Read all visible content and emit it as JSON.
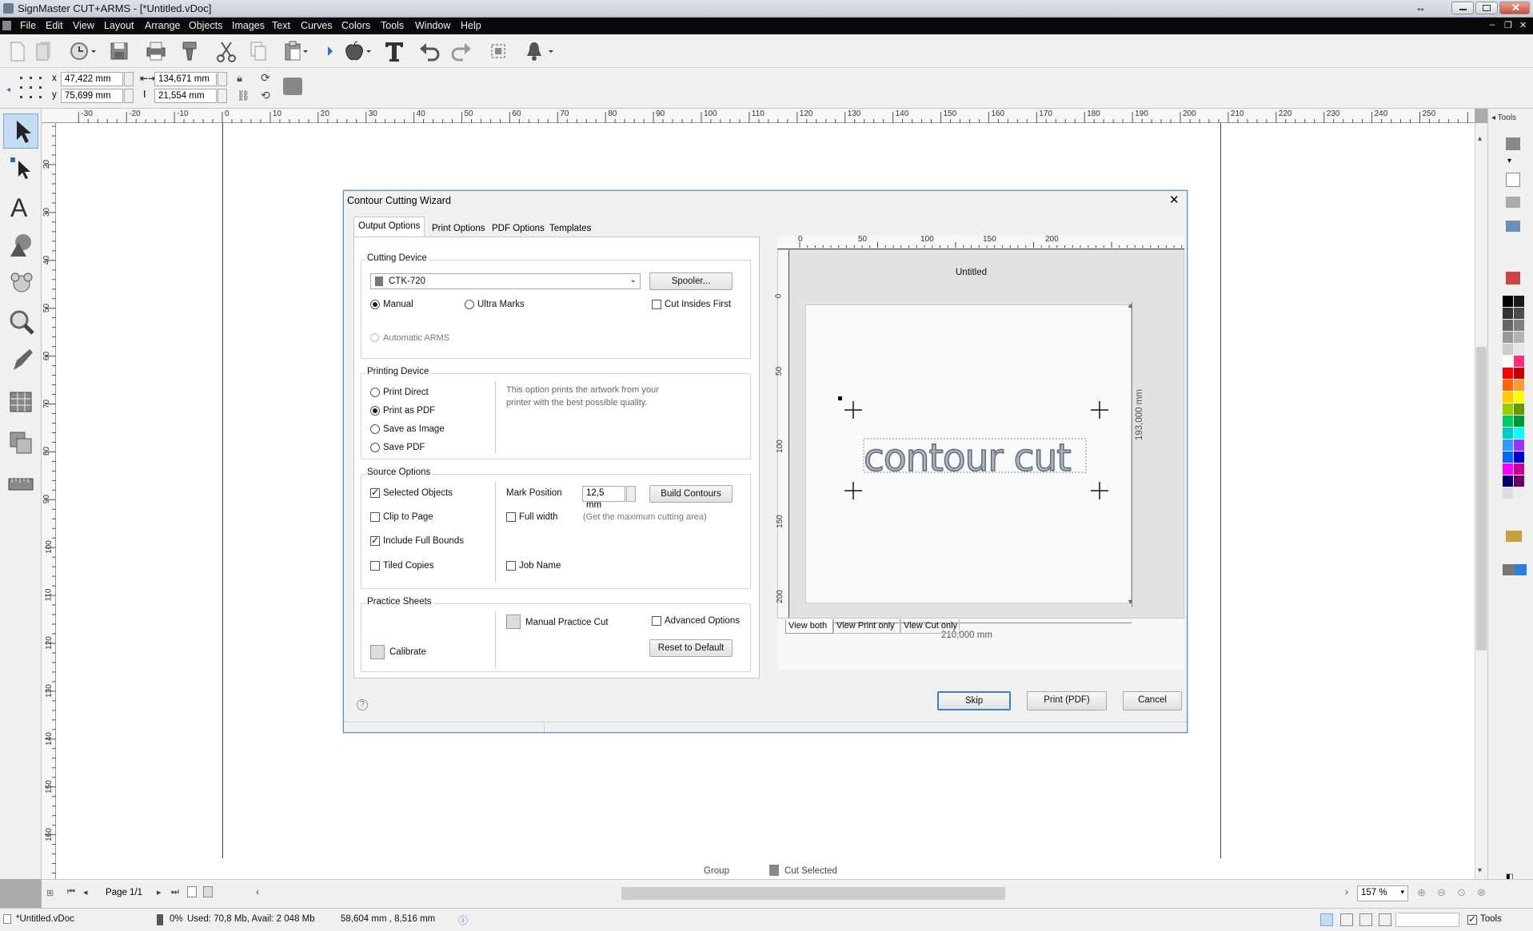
{
  "app": {
    "title": "SignMaster CUT+ARMS - [*Untitled.vDoc]"
  },
  "menu": [
    "File",
    "Edit",
    "View",
    "Layout",
    "Arrange",
    "Objects",
    "Images",
    "Text",
    "Curves",
    "Colors",
    "Tools",
    "Window",
    "Help"
  ],
  "propbar": {
    "x_label": "x",
    "x_value": "47,422 mm",
    "y_label": "y",
    "y_value": "75,699 mm",
    "w_value": "134,671 mm",
    "h_value": "21,554 mm"
  },
  "hruler_labels": [
    "-30",
    "-20",
    "-10",
    "0",
    "10",
    "20",
    "30",
    "40",
    "50",
    "60",
    "70",
    "80",
    "90",
    "100",
    "110",
    "120",
    "130",
    "140",
    "150",
    "160",
    "170",
    "180",
    "190",
    "200",
    "210",
    "220",
    "230",
    "240",
    "250"
  ],
  "vruler_labels": [
    "20",
    "30",
    "40",
    "50",
    "60",
    "70",
    "80",
    "90",
    "100",
    "110",
    "120",
    "130",
    "140",
    "150",
    "160"
  ],
  "canvas": {
    "group_label": "Group",
    "cut_selected_label": "Cut Selected"
  },
  "dialog": {
    "title": "Contour Cutting Wizard",
    "tabs": [
      "Output Options",
      "Print Options",
      "PDF Options",
      "Templates"
    ],
    "cutting_device": {
      "title": "Cutting Device",
      "device": "CTK-720",
      "spooler_button": "Spooler...",
      "manual": "Manual",
      "ultra_marks": "Ultra Marks",
      "cut_insides_first": "Cut Insides First",
      "automatic_arms": "Automatic ARMS"
    },
    "printing_device": {
      "title": "Printing Device",
      "options": [
        "Print Direct",
        "Print as PDF",
        "Save as Image",
        "Save PDF"
      ],
      "selected": "Print as PDF",
      "description": "This option prints the artwork from your printer with the best possible quality."
    },
    "source_options": {
      "title": "Source Options",
      "selected_objects": "Selected Objects",
      "clip_to_page": "Clip to Page",
      "include_full_bounds": "Include Full Bounds",
      "tiled_copies": "Tiled Copies",
      "mark_position_label": "Mark Position",
      "mark_position_value": "12,5 mm",
      "build_contours_button": "Build Contours",
      "full_width": "Full width",
      "full_width_hint": "(Get the maximum cutting area)",
      "job_name": "Job Name"
    },
    "practice_sheets": {
      "title": "Practice Sheets",
      "manual_practice_cut": "Manual Practice Cut",
      "calibrate": "Calibrate",
      "advanced_options": "Advanced Options",
      "reset_button": "Reset to Default"
    },
    "preview": {
      "ruler_labels": [
        "0",
        "50",
        "100",
        "150",
        "200"
      ],
      "vruler_labels": [
        "0",
        "50",
        "100",
        "150",
        "200"
      ],
      "doc_title": "Untitled",
      "artwork_text": "contour cut",
      "width_label": "210,000 mm",
      "height_label": "193,000 mm",
      "view_tabs": [
        "View both",
        "View Print only",
        "View Cut only"
      ]
    },
    "buttons": {
      "skip": "Skip",
      "print": "Print (PDF)",
      "cancel": "Cancel"
    },
    "help": "?"
  },
  "rightpanel": {
    "title": "Tools"
  },
  "palette": [
    "#000000",
    "#1a1a1a",
    "#333333",
    "#4d4d4d",
    "#666666",
    "#808080",
    "#999999",
    "#b3b3b3",
    "#cccccc",
    "#e6e6e6",
    "#ffffff",
    "#ff2d7f",
    "#ff0000",
    "#c00000",
    "#ff6600",
    "#ff9933",
    "#ffcc00",
    "#ffff00",
    "#99cc00",
    "#669900",
    "#00cc66",
    "#009933",
    "#00cccc",
    "#00ffff",
    "#3399ff",
    "#9933ff",
    "#0066ff",
    "#0000cc",
    "#ff00ff",
    "#cc0099",
    "#000066",
    "#660066",
    "#dddddd",
    "#eeeeee"
  ],
  "scrollbar": {
    "page_label": "Page 1/1",
    "zoom": "157 %"
  },
  "status": {
    "filename": "*Untitled.vDoc",
    "progress": "0%",
    "memory": "Used: 70,8 Mb, Avail: 2 048 Mb",
    "coords": "58,604 mm , 8,516 mm",
    "tools_label": "Tools"
  }
}
